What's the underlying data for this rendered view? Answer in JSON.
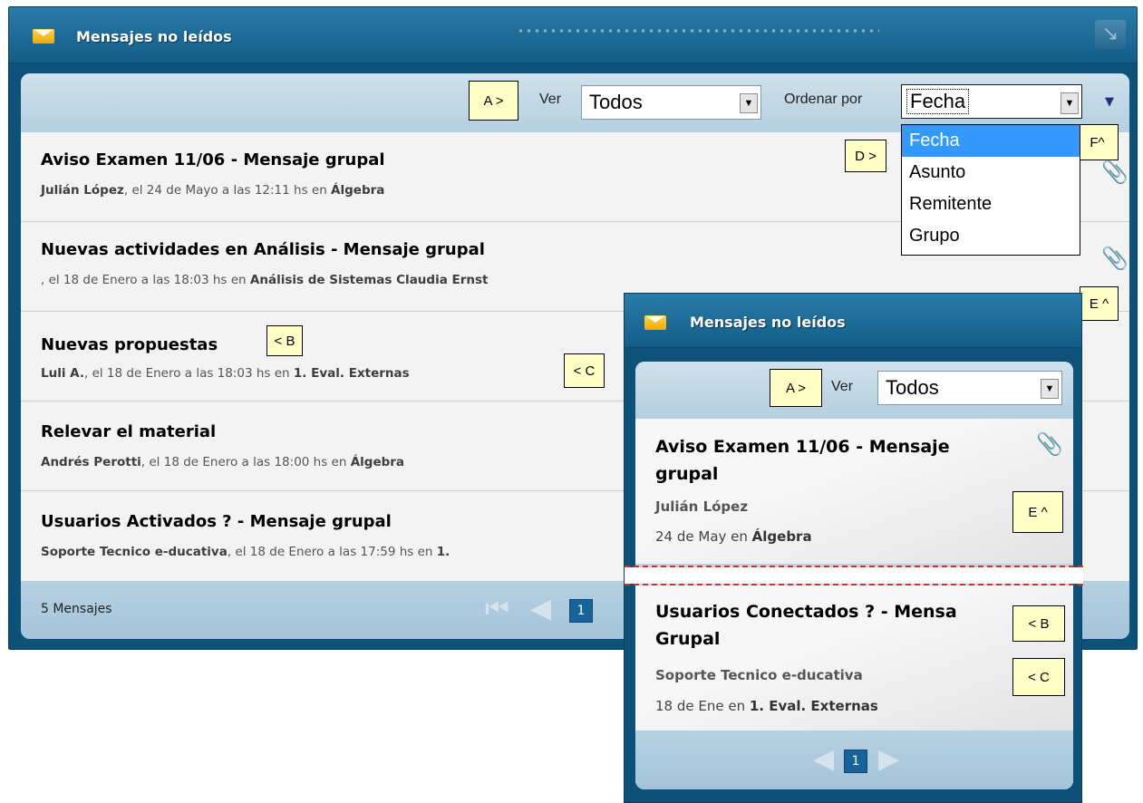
{
  "main": {
    "title": "Mensajes no leídos",
    "ver_label": "Ver",
    "ver_value": "Todos",
    "order_label": "Ordenar por",
    "order_value": "Fecha",
    "sort_direction_icon": "triangle-down-icon",
    "order_options": [
      "Fecha",
      "Asunto",
      "Remitente",
      "Grupo"
    ],
    "selected_option": "Fecha",
    "messages": [
      {
        "subject": "Aviso Examen 11/06",
        "kind": " - Mensaje grupal",
        "author": "Julián López",
        "date": ", el 24 de Mayo a las 12:11 hs en ",
        "group": "Álgebra",
        "attachment": true
      },
      {
        "subject": "Nuevas actividades en Análisis",
        "kind": " - Mensaje grupal",
        "author": "",
        "date": ", el 18 de Enero a las 18:03 hs en ",
        "group": "Análisis de Sistemas Claudia Ernst",
        "attachment": true
      },
      {
        "subject": "Nuevas propuestas",
        "kind": "",
        "author": "Luli A.",
        "date": ", el 18 de Enero a las 18:03 hs en ",
        "group": "1. Eval. Externas",
        "attachment": false
      },
      {
        "subject": "Relevar el material",
        "kind": "",
        "author": "Andrés Perotti",
        "date": ", el 18 de Enero a las 18:00 hs en ",
        "group": "Álgebra",
        "attachment": false
      },
      {
        "subject": "Usuarios Activados ?",
        "kind": " - Mensaje grupal",
        "author": "Soporte Tecnico e-ducativa",
        "date": ", el 18 de Enero a las 17:59 hs en ",
        "group": "1.",
        "attachment": false
      }
    ],
    "count": "5 Mensajes",
    "page": "1"
  },
  "notes": {
    "a": "A >",
    "b": "< B",
    "c": "< C",
    "d": "D >",
    "e": "E ^",
    "f": "F^"
  },
  "compact": {
    "title": "Mensajes no leídos",
    "ver_label": "Ver",
    "ver_value": "Todos",
    "cards": [
      {
        "subject": "Aviso Examen 11/06",
        "kind": " - Mensaje grupal",
        "author": "Julián López",
        "date": "24 de May en ",
        "group": "Álgebra",
        "attachment": true
      },
      {
        "subject": "Usuarios Conectados ?",
        "kind": " - Mensa",
        "kind2": "Grupal",
        "author": "Soporte Tecnico e-ducativa",
        "date": "18 de Ene en ",
        "group": "1. Eval. Externas",
        "attachment": false
      }
    ],
    "page": "1"
  }
}
